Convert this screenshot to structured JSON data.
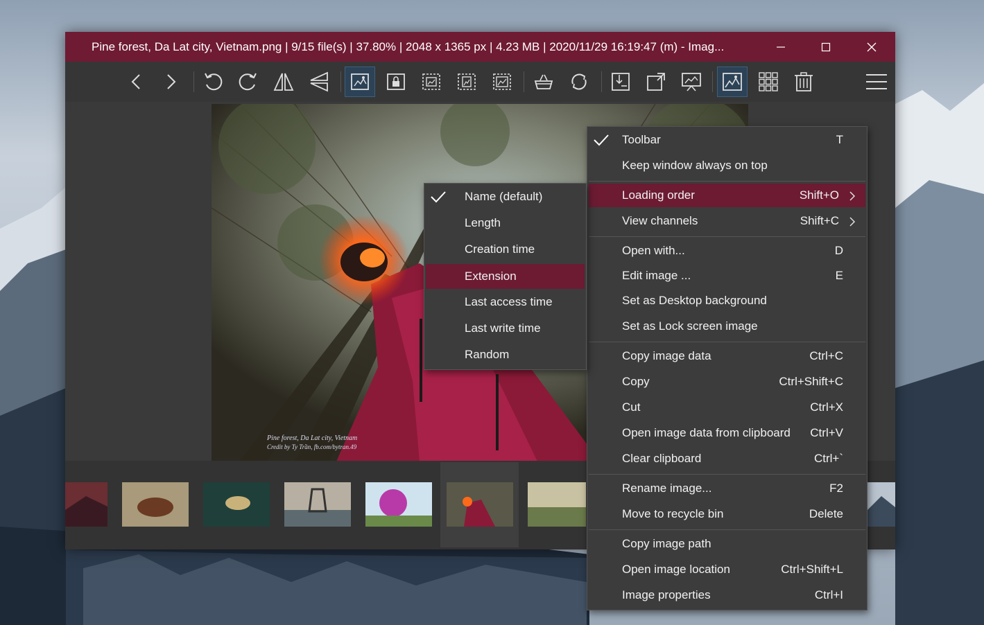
{
  "window": {
    "title": "Pine forest, Da Lat city, Vietnam.png  |  9/15 file(s)  |  37.80%  |  2048 x 1365 px  |  4.23 MB  |  2020/11/29 16:19:47 (m)  - Imag...",
    "minimize_glyph": "—",
    "maximize_glyph": "☐",
    "close_glyph": "✕"
  },
  "photo": {
    "caption_line1": "Pine forest, Da Lat city, Vietnam",
    "caption_line2": "Credit by Ty Trần, fb.com/bytran.49"
  },
  "context_menu": {
    "items": [
      {
        "label": "Toolbar",
        "shortcut": "T",
        "checked": true
      },
      {
        "label": "Keep window always on top",
        "shortcut": ""
      },
      {
        "label": "Loading order",
        "shortcut": "Shift+O",
        "submenu": true,
        "highlighted": true
      },
      {
        "label": "View channels",
        "shortcut": "Shift+C",
        "submenu": true
      },
      {
        "label": "Open with...",
        "shortcut": "D"
      },
      {
        "label": "Edit image ...",
        "shortcut": "E"
      },
      {
        "label": "Set as Desktop background",
        "shortcut": ""
      },
      {
        "label": "Set as Lock screen image",
        "shortcut": ""
      },
      {
        "label": "Copy image data",
        "shortcut": "Ctrl+C"
      },
      {
        "label": "Copy",
        "shortcut": "Ctrl+Shift+C"
      },
      {
        "label": "Cut",
        "shortcut": "Ctrl+X"
      },
      {
        "label": "Open image data from clipboard",
        "shortcut": "Ctrl+V"
      },
      {
        "label": "Clear clipboard",
        "shortcut": "Ctrl+`"
      },
      {
        "label": "Rename image...",
        "shortcut": "F2"
      },
      {
        "label": "Move to recycle bin",
        "shortcut": "Delete"
      },
      {
        "label": "Copy image path",
        "shortcut": ""
      },
      {
        "label": "Open image location",
        "shortcut": "Ctrl+Shift+L"
      },
      {
        "label": "Image properties",
        "shortcut": "Ctrl+I"
      }
    ]
  },
  "loading_order_menu": {
    "items": [
      {
        "label": "Name (default)",
        "checked": true
      },
      {
        "label": "Length"
      },
      {
        "label": "Creation time"
      },
      {
        "label": "Extension",
        "highlighted": true
      },
      {
        "label": "Last access time"
      },
      {
        "label": "Last write time"
      },
      {
        "label": "Random"
      }
    ]
  },
  "colors": {
    "accent": "#6f1b33",
    "highlight": "#6c1b33",
    "toolbar_active": "#2c4257"
  }
}
